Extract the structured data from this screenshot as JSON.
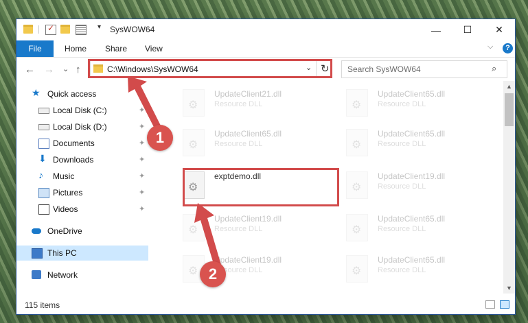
{
  "window": {
    "title": "SysWOW64",
    "min_glyph": "—",
    "max_glyph": "☐",
    "close_glyph": "✕"
  },
  "ribbon": {
    "tabs": [
      "File",
      "Home",
      "Share",
      "View"
    ],
    "collapse_glyph": "⌵",
    "help_glyph": "?"
  },
  "nav": {
    "back_glyph": "←",
    "forward_glyph": "→",
    "recent_glyph": "⌄",
    "up_glyph": "↑",
    "address": "C:\\Windows\\SysWOW64",
    "refresh_glyph": "↻",
    "address_dd_glyph": "⌄",
    "search_placeholder": "Search SysWOW64",
    "search_glyph": "⌕"
  },
  "sidebar": {
    "items": [
      {
        "label": "Quick access",
        "icon": "star-icon",
        "pinned": false
      },
      {
        "label": "Local Disk (C:)",
        "icon": "disk-icon",
        "pinned": true
      },
      {
        "label": "Local Disk (D:)",
        "icon": "disk-icon",
        "pinned": true
      },
      {
        "label": "Documents",
        "icon": "documents-icon",
        "pinned": true
      },
      {
        "label": "Downloads",
        "icon": "download-icon",
        "pinned": true
      },
      {
        "label": "Music",
        "icon": "music-icon",
        "pinned": true
      },
      {
        "label": "Pictures",
        "icon": "pictures-icon",
        "pinned": true
      },
      {
        "label": "Videos",
        "icon": "videos-icon",
        "pinned": true
      },
      {
        "label": "OneDrive",
        "icon": "cloud-icon",
        "pinned": false
      },
      {
        "label": "This PC",
        "icon": "pc-icon",
        "pinned": false
      },
      {
        "label": "Network",
        "icon": "network-icon",
        "pinned": false
      }
    ],
    "pin_glyph": "📌"
  },
  "files": [
    {
      "name": "UpdateClient21.dll",
      "type": "Resource DLL"
    },
    {
      "name": "UpdateClient65.dll",
      "type": "Resource DLL"
    },
    {
      "name": "UpdateClient65.dll",
      "type": "Resource DLL"
    },
    {
      "name": "UpdateClient65.dll",
      "type": "Resource DLL"
    },
    {
      "name": "exptdemo.dll",
      "type": ""
    },
    {
      "name": "UpdateClient19.dll",
      "type": "Resource DLL"
    },
    {
      "name": "UpdateClient19.dll",
      "type": "Resource DLL"
    },
    {
      "name": "UpdateClient65.dll",
      "type": "Resource DLL"
    },
    {
      "name": "UpdateClient19.dll",
      "type": "Resource DLL"
    },
    {
      "name": "UpdateClient65.dll",
      "type": "Resource DLL"
    }
  ],
  "status": {
    "item_count": "115 items"
  },
  "annotations": {
    "step1": "1",
    "step2": "2",
    "color": "#d24b4b"
  },
  "colors": {
    "accent": "#1979ca",
    "selection": "#cde8ff"
  }
}
